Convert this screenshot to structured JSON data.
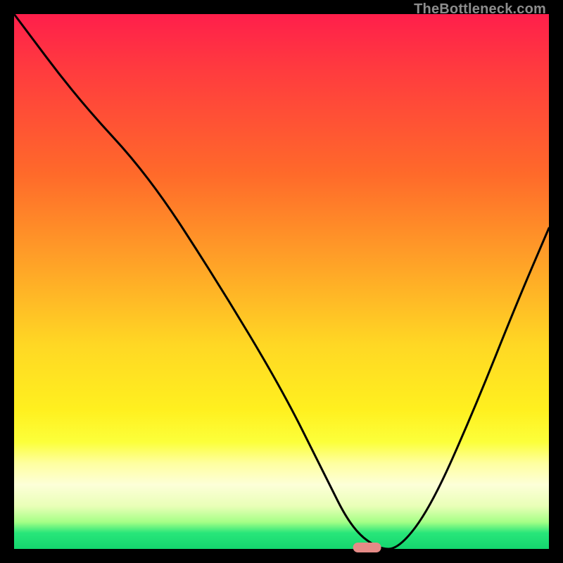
{
  "watermark": "TheBottleneck.com",
  "chart_data": {
    "type": "line",
    "title": "",
    "xlabel": "",
    "ylabel": "",
    "xlim": [
      0,
      100
    ],
    "ylim": [
      0,
      100
    ],
    "background": "red-yellow-green vertical gradient (high=red, low=green)",
    "series": [
      {
        "name": "bottleneck-curve",
        "x": [
          0,
          12,
          25,
          38,
          50,
          58,
          63,
          68,
          72,
          78,
          86,
          94,
          100
        ],
        "y": [
          100,
          84,
          70,
          50,
          30,
          14,
          4,
          0,
          0,
          8,
          26,
          46,
          60
        ]
      }
    ],
    "marker": {
      "name": "optimal-point",
      "x": 66,
      "y": 0,
      "color": "#e58b87",
      "shape": "pill"
    },
    "note": "Axes are unlabeled in the source image; x and y values are estimated from pixel positions on a 0–100 normalized scale. y=0 corresponds to the green bottom edge (no bottleneck), y=100 to the red top edge."
  }
}
